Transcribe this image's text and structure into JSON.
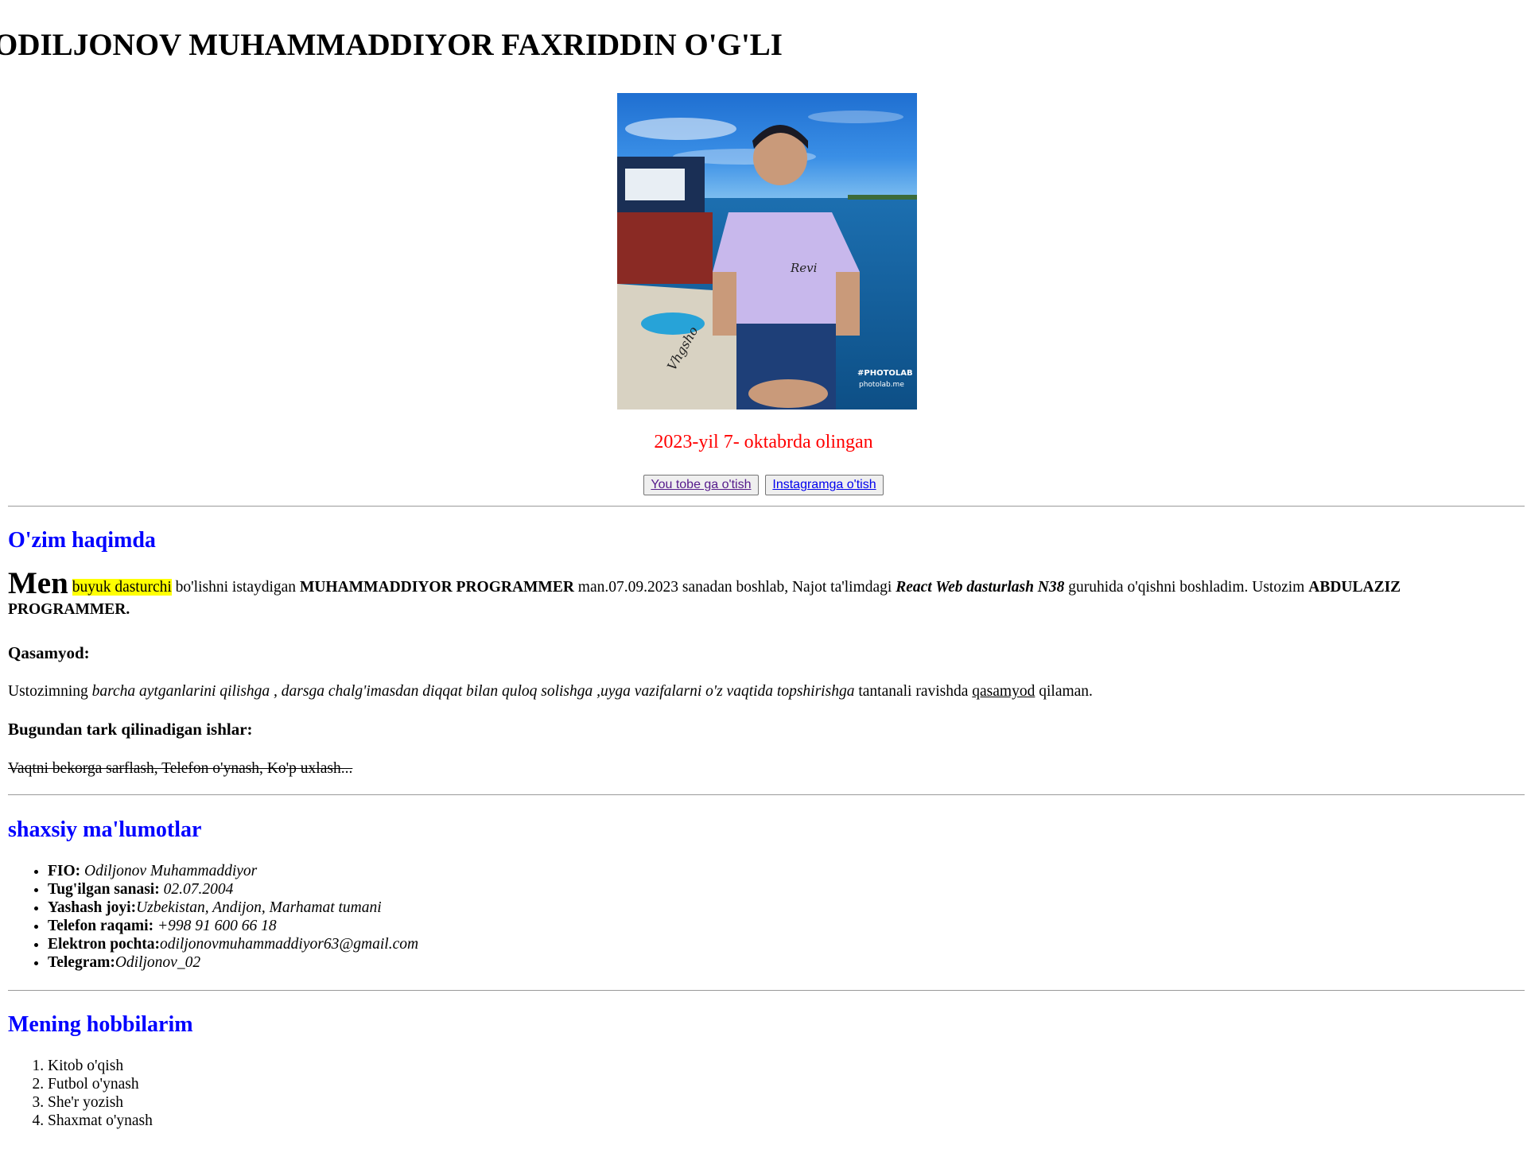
{
  "header": {
    "title": "ODILJONOV MUHAMMADDIYOR FAXRIDDIN O'G'LI"
  },
  "photo": {
    "watermark_line1": "#PHOTOLAB",
    "watermark_line2": "photolab.me",
    "signature": "Vhgsho",
    "shirt_text": "Revi"
  },
  "caption": "2023-yil 7- oktabrda olingan",
  "buttons": {
    "youtube": "You tobe ga o'tish",
    "instagram": "Instagramga o'tish"
  },
  "about": {
    "heading": "O'zim haqimda",
    "men": "Men",
    "highlight": "buyuk dasturchi",
    "text1": " bo'lishni istaydigan ",
    "bold_name": "MUHAMMADDIYOR PROGRAMMER",
    "text2": " man.07.09.2023 sanadan boshlab, Najot ta'limdagi ",
    "course": "React Web dasturlash N38",
    "text3": " guruhida o'qishni boshladim. Ustozim ",
    "teacher": "ABDULAZIZ PROGRAMMER."
  },
  "oath": {
    "heading": "Qasamyod:",
    "text1": "Ustozimning ",
    "italic": "barcha aytganlarini qilishga , darsga chalg'imasdan diqqat bilan quloq solishga ,uyga vazifalarni o'z vaqtida topshirishga",
    "text2": " tantanali ravishda ",
    "underline": "qasamyod",
    "text3": " qilaman."
  },
  "quit": {
    "heading": "Bugundan tark qilinadigan ishlar:",
    "text": "Vaqtni bekorga sarflash, Telefon o'ynash, Ko'p uxlash..."
  },
  "personal": {
    "heading": "shaxsiy ma'lumotlar",
    "items": [
      {
        "label": "FIO: ",
        "value": "Odiljonov Muhammaddiyor"
      },
      {
        "label": "Tug'ilgan sanasi: ",
        "value": "02.07.2004"
      },
      {
        "label": "Yashash joyi:",
        "value": "Uzbekistan, Andijon, Marhamat tumani"
      },
      {
        "label": "Telefon raqami: ",
        "value": "+998 91 600 66 18"
      },
      {
        "label": "Elektron pochta:",
        "value": "odiljonovmuhammaddiyor63@gmail.com"
      },
      {
        "label": "Telegram:",
        "value": "Odiljonov_02"
      }
    ]
  },
  "hobbies": {
    "heading": "Mening hobbilarim",
    "items": [
      "Kitob o'qish",
      "Futbol o'ynash",
      "She'r yozish",
      "Shaxmat o'ynash"
    ]
  },
  "colors": {
    "heading_blue": "#0000ff",
    "caption_red": "#ff0000",
    "highlight_yellow": "#ffff00",
    "link_visited": "#551a8b",
    "link_unvisited": "#0000ee"
  }
}
